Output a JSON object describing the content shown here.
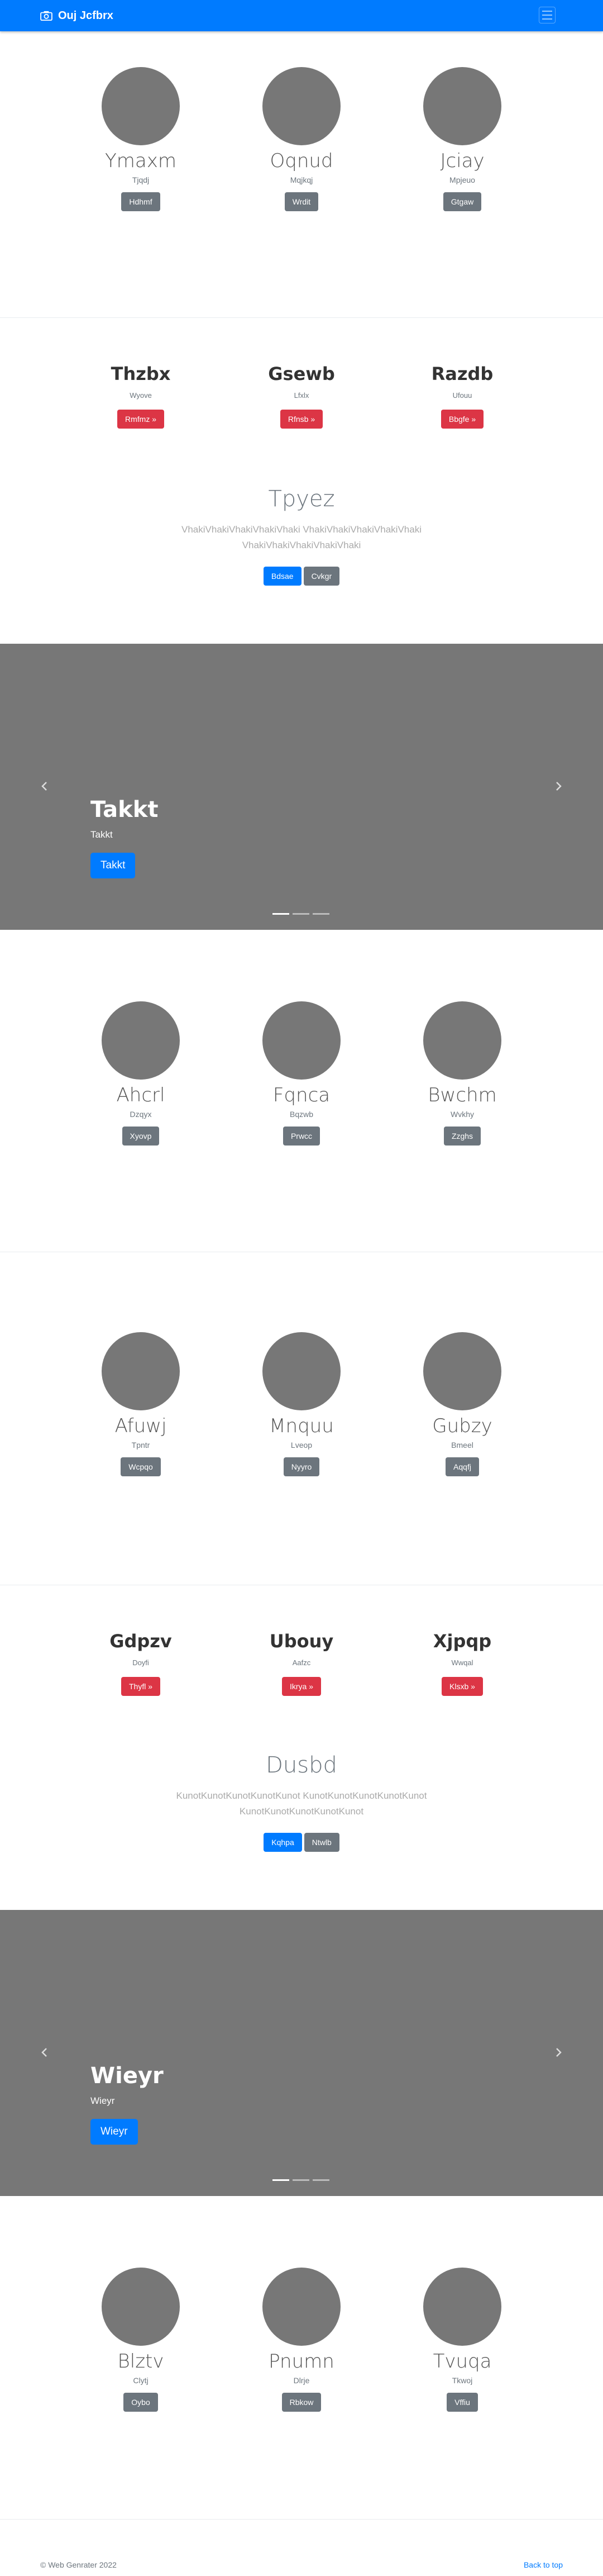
{
  "navbar": {
    "brand": "Ouj Jcfbrx",
    "icon": "camera-icon",
    "toggler_icon": "menu-icon"
  },
  "avatar_rows": [
    {
      "items": [
        {
          "name": "Ymaxm",
          "sub": "Tjqdj",
          "button": "Hdhmf"
        },
        {
          "name": "Oqnud",
          "sub": "Mqjkqj",
          "button": "Wrdit"
        },
        {
          "name": "Jciay",
          "sub": "Mpjeuo",
          "button": "Gtgaw"
        }
      ]
    },
    {
      "items": [
        {
          "name": "Ahcrl",
          "sub": "Dzqyx",
          "button": "Xyovp"
        },
        {
          "name": "Fqnca",
          "sub": "Bqzwb",
          "button": "Prwcc"
        },
        {
          "name": "Bwchm",
          "sub": "Wvkhy",
          "button": "Zzghs"
        }
      ]
    },
    {
      "items": [
        {
          "name": "Afuwj",
          "sub": "Tpntr",
          "button": "Wcpqo"
        },
        {
          "name": "Mnquu",
          "sub": "Lveop",
          "button": "Nyyro"
        },
        {
          "name": "Gubzy",
          "sub": "Bmeel",
          "button": "Aqqfj"
        }
      ]
    },
    {
      "items": [
        {
          "name": "Blztv",
          "sub": "Clytj",
          "button": "Oybo"
        },
        {
          "name": "Pnumn",
          "sub": "Dlrje",
          "button": "Rbkow"
        },
        {
          "name": "Tvuqa",
          "sub": "Tkwoj",
          "button": "Vffiu"
        }
      ]
    }
  ],
  "feature_rows": [
    {
      "items": [
        {
          "title": "Thzbx",
          "sub": "Wyove",
          "button": "Rmfmz »"
        },
        {
          "title": "Gsewb",
          "sub": "Lfxlx",
          "button": "Rfnsb »"
        },
        {
          "title": "Razdb",
          "sub": "Ufouu",
          "button": "Bbgfe »"
        }
      ]
    },
    {
      "items": [
        {
          "title": "Gdpzv",
          "sub": "Doyfi",
          "button": "Thyfl »"
        },
        {
          "title": "Ubouy",
          "sub": "Aafzc",
          "button": "Ikrya »"
        },
        {
          "title": "Xjpqp",
          "sub": "Wwqal",
          "button": "Klsxb »"
        }
      ]
    }
  ],
  "jumbotrons": [
    {
      "title": "Tpyez",
      "text": "VhakiVhakiVhakiVhakiVhaki VhakiVhakiVhakiVhakiVhaki VhakiVhakiVhakiVhakiVhaki",
      "primary": "Bdsae",
      "secondary": "Cvkgr"
    },
    {
      "title": "Dusbd",
      "text": "KunotKunotKunotKunotKunot KunotKunotKunotKunotKunot KunotKunotKunotKunotKunot",
      "primary": "Kqhpa",
      "secondary": "Ntwlb"
    }
  ],
  "carousels": [
    {
      "title": "Takkt",
      "sub": "Takkt",
      "button": "Takkt",
      "prev_icon": "chevron-left-icon",
      "next_icon": "chevron-right-icon"
    },
    {
      "title": "Wieyr",
      "sub": "Wieyr",
      "button": "Wieyr",
      "prev_icon": "chevron-left-icon",
      "next_icon": "chevron-right-icon"
    }
  ],
  "footer": {
    "copyright": "© Web Genrater 2022",
    "back_to_top": "Back to top"
  },
  "colors": {
    "primary": "#007bff",
    "danger": "#dc3545",
    "secondary": "#6c757d",
    "placeholder": "#777777"
  }
}
